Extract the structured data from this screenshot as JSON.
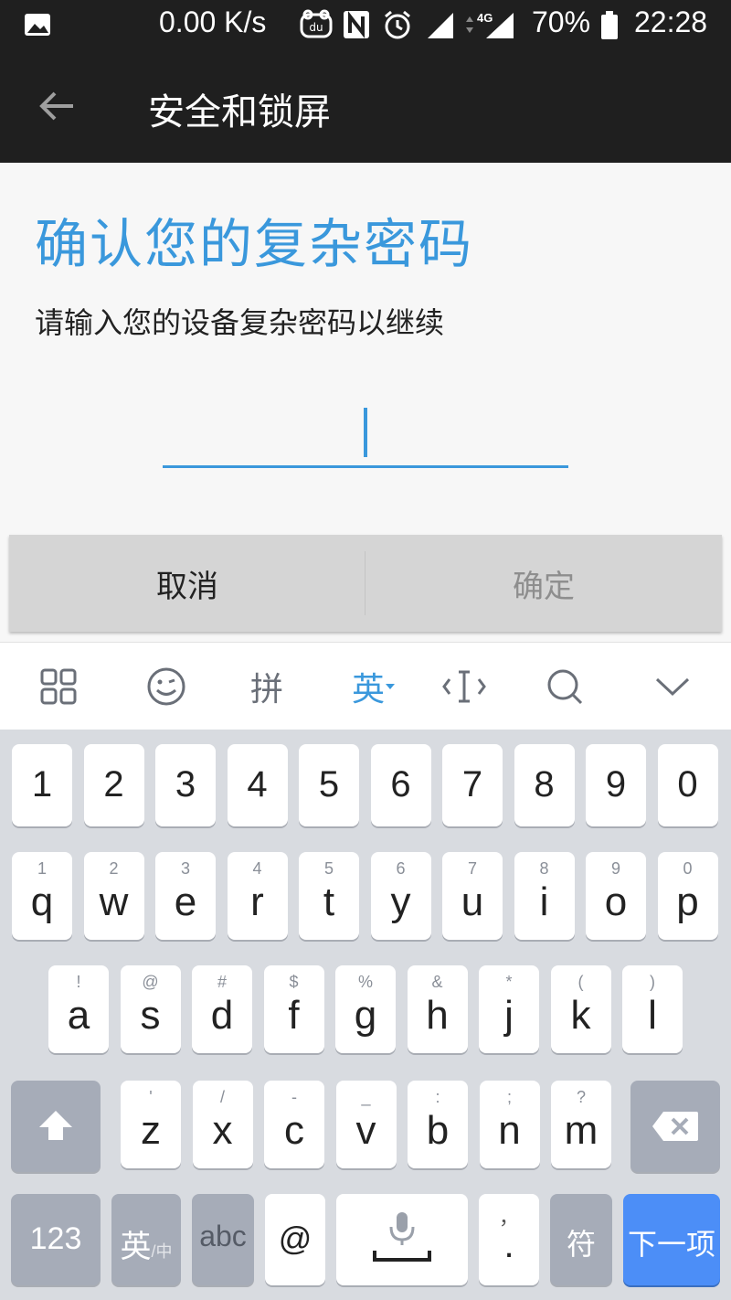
{
  "status_bar": {
    "speed": "0.00 K/s",
    "battery": "70%",
    "time": "22:28",
    "network": "4G",
    "icons": [
      "image-icon",
      "du-icon",
      "nfc-icon",
      "alarm-icon",
      "signal-icon",
      "4g-signal-icon",
      "battery-icon"
    ]
  },
  "app_bar": {
    "title": "安全和锁屏",
    "back_icon": "arrow-left-icon"
  },
  "content": {
    "heading": "确认您的复杂密码",
    "subtext": "请输入您的设备复杂密码以继续",
    "password_value": ""
  },
  "buttons": {
    "cancel": "取消",
    "ok": "确定"
  },
  "ime_toolbar": {
    "items": [
      "grid-icon",
      "emoji-icon",
      "拼",
      "英",
      "cursor-icon",
      "search-icon",
      "collapse-icon"
    ],
    "pinyin_label": "拼",
    "english_label": "英"
  },
  "keyboard": {
    "numbers": [
      "1",
      "2",
      "3",
      "4",
      "5",
      "6",
      "7",
      "8",
      "9",
      "0"
    ],
    "row_q": [
      {
        "k": "q",
        "s": "1"
      },
      {
        "k": "w",
        "s": "2"
      },
      {
        "k": "e",
        "s": "3"
      },
      {
        "k": "r",
        "s": "4"
      },
      {
        "k": "t",
        "s": "5"
      },
      {
        "k": "y",
        "s": "6"
      },
      {
        "k": "u",
        "s": "7"
      },
      {
        "k": "i",
        "s": "8"
      },
      {
        "k": "o",
        "s": "9"
      },
      {
        "k": "p",
        "s": "0"
      }
    ],
    "row_a": [
      {
        "k": "a",
        "s": "!"
      },
      {
        "k": "s",
        "s": "@"
      },
      {
        "k": "d",
        "s": "#"
      },
      {
        "k": "f",
        "s": "$"
      },
      {
        "k": "g",
        "s": "%"
      },
      {
        "k": "h",
        "s": "&"
      },
      {
        "k": "j",
        "s": "*"
      },
      {
        "k": "k",
        "s": "("
      },
      {
        "k": "l",
        "s": ")"
      }
    ],
    "row_z": [
      {
        "k": "z",
        "s": "'"
      },
      {
        "k": "x",
        "s": "/"
      },
      {
        "k": "c",
        "s": "-"
      },
      {
        "k": "v",
        "s": "_"
      },
      {
        "k": "b",
        "s": ":"
      },
      {
        "k": "n",
        "s": ";"
      },
      {
        "k": "m",
        "s": "?"
      }
    ],
    "key_123": "123",
    "key_lang": "英",
    "key_lang_small": "/中",
    "key_abc": "abc",
    "key_at": "@",
    "key_comma": "，",
    "key_period": ".",
    "key_symbols": "符",
    "key_next": "下一项"
  }
}
